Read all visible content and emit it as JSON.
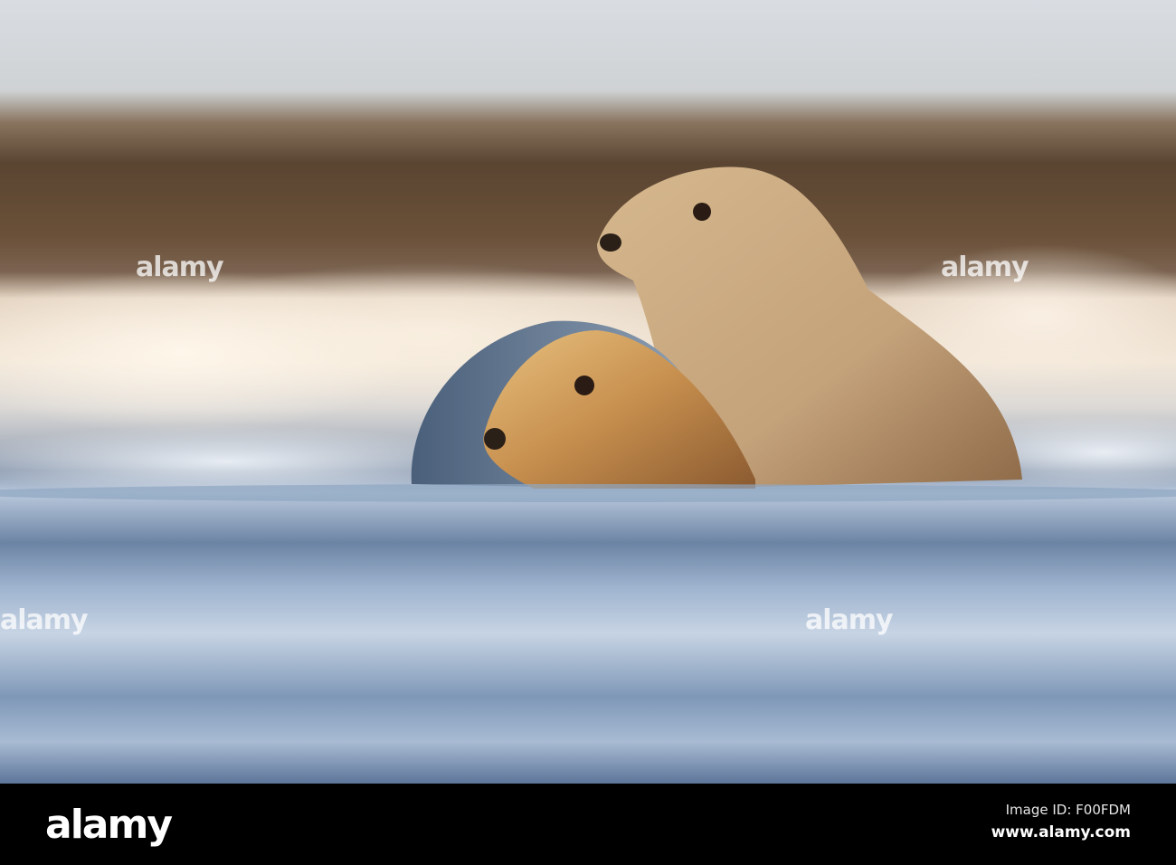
{
  "watermark": {
    "text": "alamy"
  },
  "footer": {
    "logo": "alamy",
    "image_id": "Image ID: F00FDM",
    "website": "www.alamy.com"
  }
}
